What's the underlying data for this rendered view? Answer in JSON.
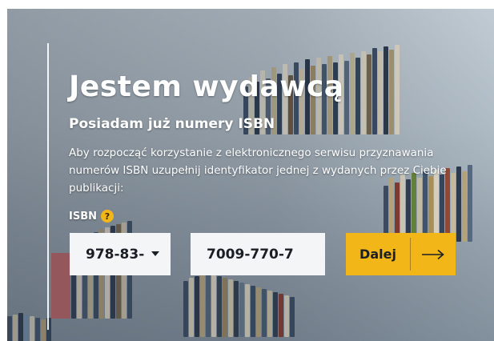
{
  "hero": {
    "title": "Jestem wydawcą",
    "subtitle": "Posiadam już numery ISBN",
    "description": "Aby rozpocząć korzystanie z elektronicznego serwisu przyznawania numerów ISBN uzupełnij identyfikator jednej z wydanych przez Ciebie publikacji:"
  },
  "form": {
    "isbn_label": "ISBN",
    "help_icon": "question-icon",
    "prefix_value": "978-83-",
    "number_value": "7009-770-7",
    "submit_label": "Dalej",
    "submit_icon": "arrow-right-icon"
  },
  "colors": {
    "accent": "#f2b619",
    "field_bg": "#f4f5f6",
    "text_dark": "#1a1f26"
  }
}
